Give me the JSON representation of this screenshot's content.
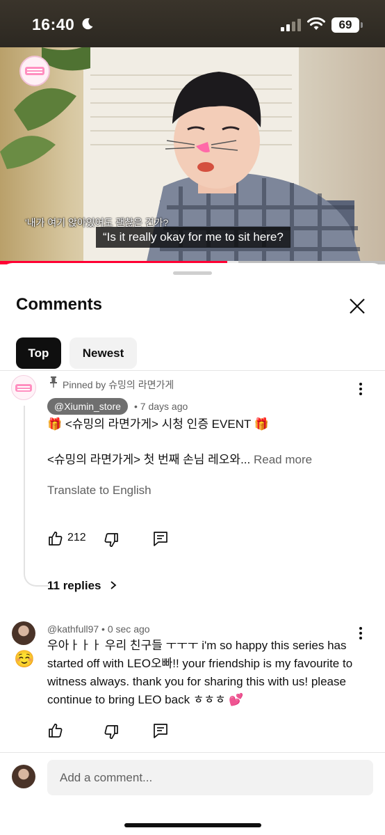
{
  "status_bar": {
    "time": "16:40",
    "battery": "69"
  },
  "video": {
    "subtitle_korean": "'내가 여기 앉아있어도 괜찮은 건가?",
    "subtitle_english": "“Is it really okay for me to sit here?",
    "progress_fraction": 0.59,
    "buffered_fraction": 0.62,
    "progress_color": "#ff0033"
  },
  "panel": {
    "title": "Comments",
    "close_icon": "close-icon",
    "filters": [
      {
        "label": "Top",
        "selected": true
      },
      {
        "label": "Newest",
        "selected": false
      }
    ]
  },
  "comments": [
    {
      "pinned_by": "Pinned by 슈밍의 라면가게",
      "author": "@Xiumin_store",
      "time": "7 days ago",
      "line1": "🎁 <슈밍의 라면가게> 시청 인증 EVENT 🎁",
      "line2": "<슈밍의 라면가게> 첫 번째 손님 레오와...",
      "read_more": "Read more",
      "translate": "Translate to English",
      "likes": "212",
      "replies": "11 replies"
    },
    {
      "author": "@kathfull97",
      "time": "0 sec ago",
      "badge_emoji": "☺️",
      "text": "우아ㅏㅏㅏ 우리 친구들 ㅜㅜㅜ i'm so happy this series has started off with LEO오빠!! your friendship is my favourite to witness always. thank you for sharing this with us! please continue to bring LEO back ㅎㅎㅎ 💕"
    }
  ],
  "composer": {
    "placeholder": "Add a comment..."
  }
}
